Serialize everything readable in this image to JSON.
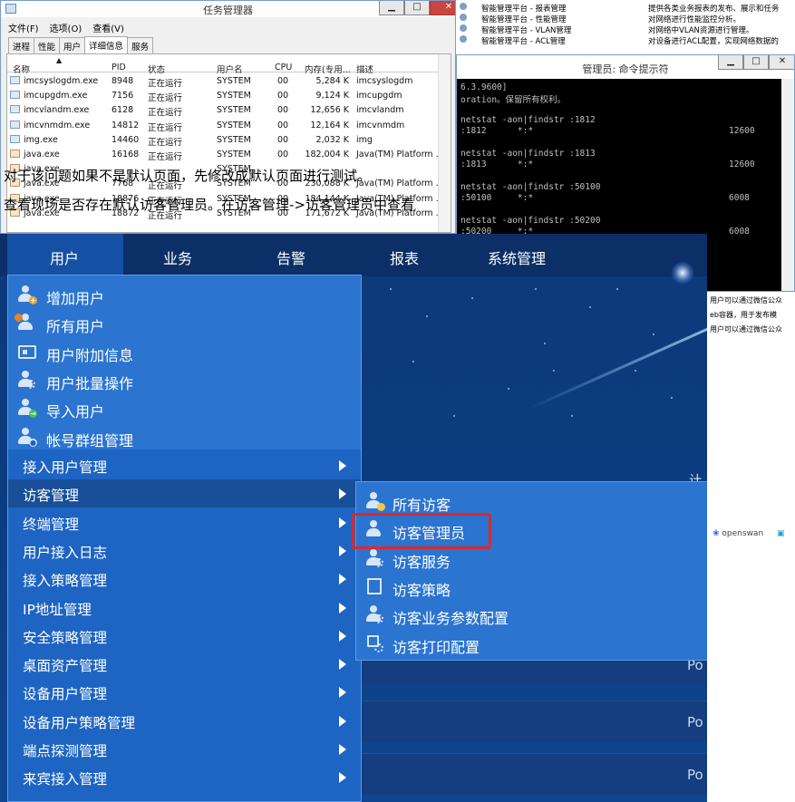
{
  "task_manager": {
    "title": "任务管理器",
    "menu": [
      "文件(F)",
      "选项(O)",
      "查看(V)"
    ],
    "tabs": [
      "进程",
      "性能",
      "用户",
      "详细信息",
      "服务"
    ],
    "active_tab": "详细信息",
    "columns": [
      "名称",
      "PID",
      "状态",
      "用户名",
      "CPU",
      "内存(专用...",
      "描述"
    ],
    "rows": [
      {
        "name": "imcsyslogdm.exe",
        "pid": "8948",
        "status": "正在运行",
        "user": "SYSTEM",
        "cpu": "00",
        "mem": "5,284 K",
        "desc": "imcsyslogdm",
        "icon": "exe-icon"
      },
      {
        "name": "imcupgdm.exe",
        "pid": "7156",
        "status": "正在运行",
        "user": "SYSTEM",
        "cpu": "00",
        "mem": "9,124 K",
        "desc": "imcupgdm",
        "icon": "exe-icon"
      },
      {
        "name": "imcvlandm.exe",
        "pid": "6128",
        "status": "正在运行",
        "user": "SYSTEM",
        "cpu": "00",
        "mem": "12,656 K",
        "desc": "imcvlandm",
        "icon": "exe-icon"
      },
      {
        "name": "imcvnmdm.exe",
        "pid": "14812",
        "status": "正在运行",
        "user": "SYSTEM",
        "cpu": "00",
        "mem": "12,164 K",
        "desc": "imcvnmdm",
        "icon": "exe-icon"
      },
      {
        "name": "img.exe",
        "pid": "14460",
        "status": "正在运行",
        "user": "SYSTEM",
        "cpu": "00",
        "mem": "2,032 K",
        "desc": "img",
        "icon": "exe-icon"
      },
      {
        "name": "java.exe",
        "pid": "16168",
        "status": "正在运行",
        "user": "SYSTEM",
        "cpu": "00",
        "mem": "182,004 K",
        "desc": "Java(TM) Platform ...",
        "icon": "java-icon"
      },
      {
        "name": "java.exe",
        "pid": "",
        "status": "",
        "user": "SYSTEM",
        "cpu": "",
        "mem": "",
        "desc": "",
        "icon": "java-icon"
      },
      {
        "name": "java.exe",
        "pid": "7768",
        "status": "正在运行",
        "user": "SYSTEM",
        "cpu": "00",
        "mem": "230,088 K",
        "desc": "Java(TM) Platform ...",
        "icon": "java-icon"
      },
      {
        "name": "java.exe",
        "pid": "18876",
        "status": "正在运行",
        "user": "SYSTEM",
        "cpu": "00",
        "mem": "184,144 K",
        "desc": "Java(TM) Platform ...",
        "icon": "java-icon"
      },
      {
        "name": "java.exe",
        "pid": "18872",
        "status": "正在运行",
        "user": "SYSTEM",
        "cpu": "00",
        "mem": "171,672 K",
        "desc": "Java(TM) Platform ...",
        "icon": "java-icon"
      }
    ]
  },
  "services": [
    {
      "name": "智能管理平台 - 报表管理",
      "desc": "提供各类业务报表的发布、展示和任务"
    },
    {
      "name": "智能管理平台 - 性能管理",
      "desc": "对网络进行性能监控分析。"
    },
    {
      "name": "智能管理平台 - VLAN管理",
      "desc": "对网络中VLAN资源进行管理。"
    },
    {
      "name": "智能管理平台 - ACL管理",
      "desc": "对设备进行ACL配置，实现网络数据的"
    }
  ],
  "services_below": [
    "用户可以通过微信公众",
    "eb容器，用于发布模",
    "用户可以通过微信公众"
  ],
  "cmd": {
    "title": "管理员: 命令提示符",
    "lines": [
      {
        "text": "6.3.9600]",
        "num": ""
      },
      {
        "text": "oration。保留所有权利。",
        "num": ""
      },
      {
        "text": "netstat -aon|findstr :1812",
        "num": ""
      },
      {
        "text": ":1812      *:*",
        "num": "12600"
      },
      {
        "text": "netstat -aon|findstr :1813",
        "num": ""
      },
      {
        "text": ":1813      *:*",
        "num": "12600"
      },
      {
        "text": "netstat -aon|findstr :50100",
        "num": ""
      },
      {
        "text": ":50100     *:*",
        "num": "6008"
      },
      {
        "text": "netstat -aon|findstr :50200",
        "num": ""
      },
      {
        "text": ":50200     *:*",
        "num": "6008"
      }
    ]
  },
  "annotations": [
    "对于该问题如果不是默认页面，先修改成默认页面进行测试。",
    "查看现场是否存在默认访客管理员。在访客管理->访客管理员中查看"
  ],
  "nav": {
    "items": [
      "用户",
      "业务",
      "告警",
      "报表",
      "系统管理"
    ],
    "active": "用户"
  },
  "user_menu": {
    "top_items": [
      {
        "label": "增加用户",
        "icon": "add-user-icon"
      },
      {
        "label": "所有用户",
        "icon": "all-users-icon"
      },
      {
        "label": "用户附加信息",
        "icon": "user-card-icon"
      },
      {
        "label": "用户批量操作",
        "icon": "batch-users-icon"
      },
      {
        "label": "导入用户",
        "icon": "import-user-icon"
      },
      {
        "label": "帐号群组管理",
        "icon": "group-icon"
      }
    ],
    "sub_items": [
      {
        "label": "接入用户管理"
      },
      {
        "label": "访客管理",
        "selected": true
      },
      {
        "label": "终端管理"
      },
      {
        "label": "用户接入日志"
      },
      {
        "label": "接入策略管理"
      },
      {
        "label": "IP地址管理"
      },
      {
        "label": "安全策略管理"
      },
      {
        "label": "桌面资产管理"
      },
      {
        "label": "设备用户管理"
      },
      {
        "label": "设备用户策略管理"
      },
      {
        "label": "端点探测管理"
      },
      {
        "label": "来宾接入管理"
      }
    ]
  },
  "guest_submenu": {
    "items": [
      {
        "label": "所有访客",
        "icon": "all-guests-icon"
      },
      {
        "label": "访客管理员",
        "icon": "guest-admin-icon",
        "highlighted": true
      },
      {
        "label": "访客服务",
        "icon": "guest-service-icon"
      },
      {
        "label": "访客策略",
        "icon": "guest-policy-icon"
      },
      {
        "label": "访客业务参数配置",
        "icon": "guest-params-icon"
      },
      {
        "label": "访客打印配置",
        "icon": "guest-print-icon"
      }
    ]
  },
  "background_fragments": {
    "side_text": "Po",
    "browser_bookmark": "openswan",
    "right_marker": "计"
  },
  "colors": {
    "nav_bg": "#0b2f66",
    "menu_bg": "#1e64c2",
    "highlight_border": "#e0262b"
  }
}
